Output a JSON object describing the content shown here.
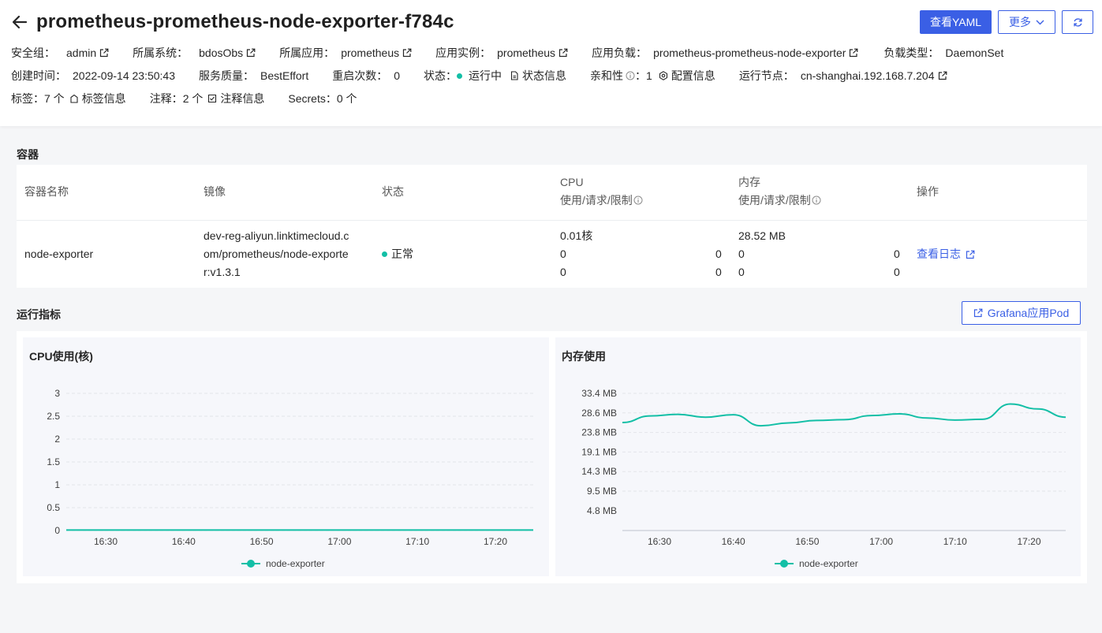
{
  "header": {
    "title": "prometheus-prometheus-node-exporter-f784c",
    "buttons": {
      "view_yaml": "查看YAML",
      "more": "更多"
    },
    "row1": [
      {
        "label": "安全组：",
        "value": "admin",
        "link": true
      },
      {
        "label": "所属系统：",
        "value": "bdosObs",
        "link": true
      },
      {
        "label": "所属应用：",
        "value": "prometheus",
        "link": true
      },
      {
        "label": "应用实例：",
        "value": "prometheus",
        "link": true
      },
      {
        "label": "应用负载：",
        "value": "prometheus-prometheus-node-exporter",
        "link": true
      },
      {
        "label": "负载类型：",
        "value": "DaemonSet",
        "link": false
      }
    ],
    "row2": {
      "created_label": "创建时间：",
      "created_value": "2022-09-14 23:50:43",
      "qos_label": "服务质量：",
      "qos_value": "BestEffort",
      "restart_label": "重启次数：",
      "restart_value": "0",
      "status_label": "状态：",
      "status_value": "运行中",
      "status_info": "状态信息",
      "affinity_label": "亲和性",
      "affinity_value": "：1",
      "config_info": "配置信息",
      "node_label": "运行节点：",
      "node_value": "cn-shanghai.192.168.7.204"
    },
    "row3": {
      "labels_label": "标签：",
      "labels_value": "7 个",
      "labels_info": "标签信息",
      "annotations_label": "注释：",
      "annotations_value": "2 个",
      "annotations_info": "注释信息",
      "secrets_label": "Secrets：",
      "secrets_value": "0 个"
    }
  },
  "containers": {
    "section_title": "容器",
    "columns": {
      "name": "容器名称",
      "image": "镜像",
      "status": "状态",
      "cpu": "CPU",
      "cpu_sub": "使用/请求/限制",
      "memory": "内存",
      "memory_sub": "使用/请求/限制",
      "actions": "操作"
    },
    "row": {
      "name": "node-exporter",
      "image_lines": [
        "dev-reg-aliyun.linktimecloud.c",
        "om/prometheus/node-exporte",
        "r:v1.3.1"
      ],
      "status": "正常",
      "cpu_usage": "0.01核",
      "cpu_request": "0",
      "cpu_request_right": "0",
      "cpu_limit": "0",
      "cpu_limit_right": "0",
      "mem_usage": "28.52 MB",
      "mem_request": "0",
      "mem_request_right": "0",
      "mem_limit": "0",
      "mem_limit_right": "0",
      "action": "查看日志"
    }
  },
  "metrics": {
    "section_title": "运行指标",
    "grafana_button": "Grafana应用Pod"
  },
  "colors": {
    "accent": "#3a5fe5",
    "series": "#13bfa6"
  },
  "chart_data": [
    {
      "type": "line",
      "title": "CPU使用(核)",
      "x": [
        "16:30",
        "16:40",
        "16:50",
        "17:00",
        "17:10",
        "17:20"
      ],
      "xticks": [
        "16:30",
        "16:40",
        "16:50",
        "17:00",
        "17:10",
        "17:20"
      ],
      "yticks": [
        "3",
        "2.5",
        "2",
        "1.5",
        "1",
        "0.5",
        "0"
      ],
      "ylim": [
        0,
        3
      ],
      "grid": true,
      "legend": "bottom",
      "series": [
        {
          "name": "node-exporter",
          "values": [
            0.01,
            0.01,
            0.01,
            0.01,
            0.01,
            0.01,
            0.01,
            0.01,
            0.01,
            0.01,
            0.01,
            0.01,
            0.01,
            0.01
          ]
        }
      ]
    },
    {
      "type": "line",
      "title": "内存使用",
      "x": [
        "16:30",
        "16:40",
        "16:50",
        "17:00",
        "17:10",
        "17:20"
      ],
      "xticks": [
        "16:30",
        "16:40",
        "16:50",
        "17:00",
        "17:10",
        "17:20"
      ],
      "yticks": [
        "33.4 MB",
        "28.6 MB",
        "23.8 MB",
        "19.1 MB",
        "14.3 MB",
        "9.5 MB",
        "4.8 MB"
      ],
      "ylim_mb": [
        0,
        33.4
      ],
      "grid": true,
      "legend": "bottom",
      "series": [
        {
          "name": "node-exporter",
          "values_mb": [
            26.3,
            27.9,
            28.3,
            27.6,
            28.2,
            25.5,
            26.2,
            26.8,
            27.0,
            28.0,
            28.4,
            27.4,
            26.9,
            27.1,
            30.8,
            29.6,
            27.6
          ]
        }
      ]
    }
  ]
}
